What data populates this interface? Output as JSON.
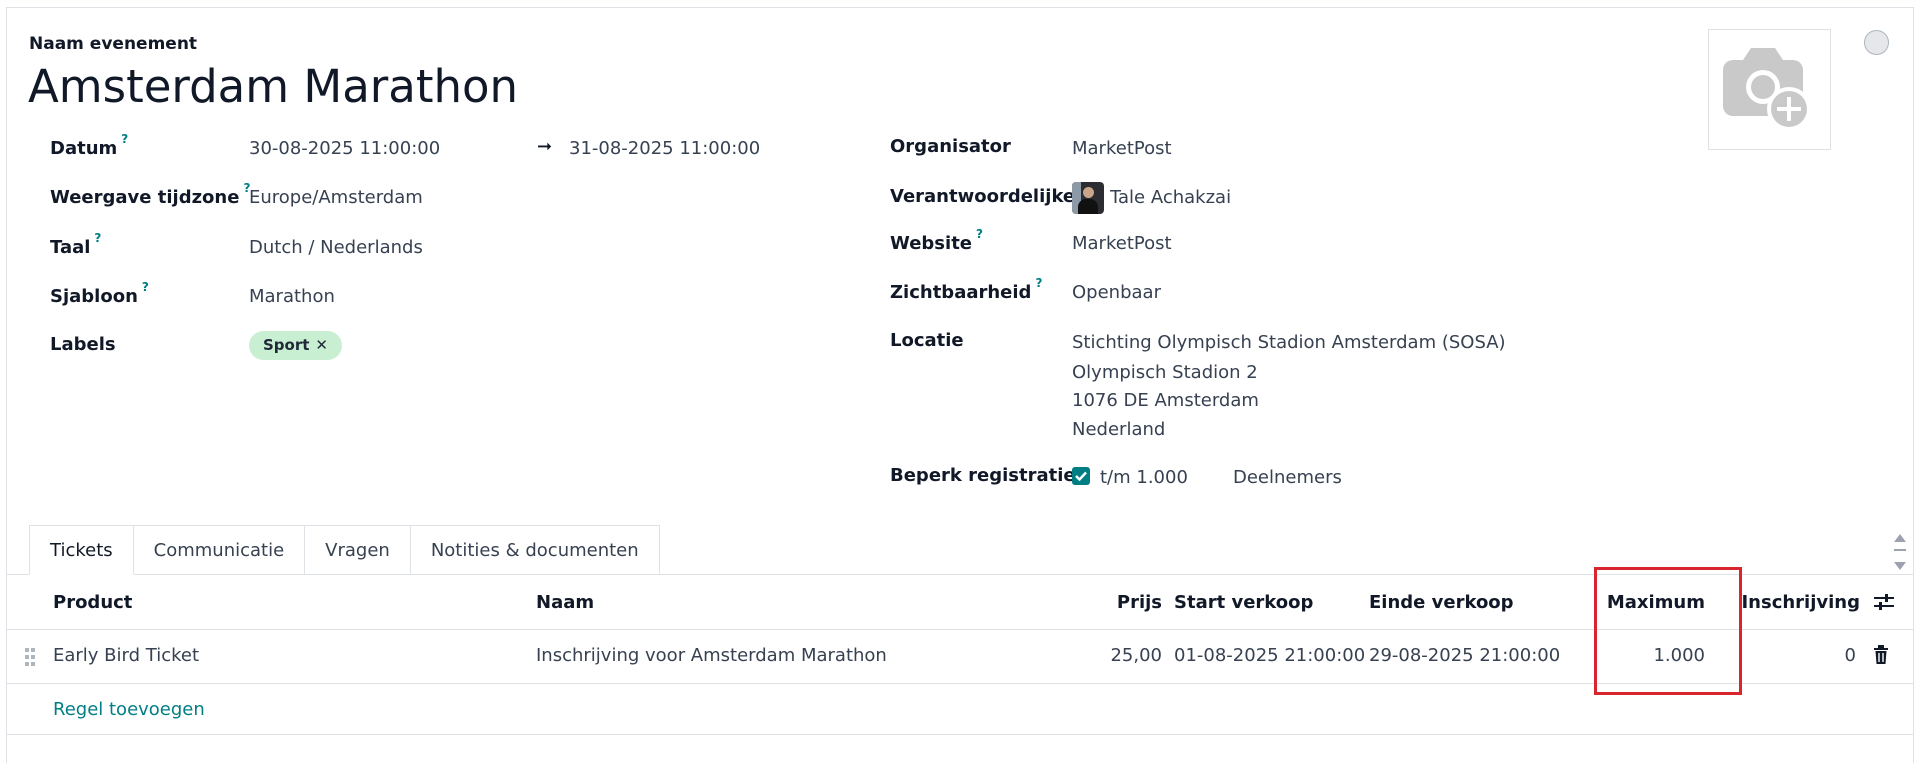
{
  "form": {
    "name_label": "Naam evenement",
    "title": "Amsterdam Marathon",
    "help_mark": "?"
  },
  "left_fields": {
    "datum": {
      "label": "Datum",
      "start": "30-08-2025 11:00:00",
      "arrow": "➞",
      "end": "31-08-2025 11:00:00"
    },
    "timezone": {
      "label": "Weergave tijdzone",
      "value": "Europe/Amsterdam"
    },
    "language": {
      "label": "Taal",
      "value": "Dutch / Nederlands"
    },
    "template": {
      "label": "Sjabloon",
      "value": "Marathon"
    },
    "labels": {
      "label": "Labels",
      "tag": "Sport",
      "tag_remove": "✕",
      "tag_color": "#c8efd2"
    }
  },
  "right_fields": {
    "organizer": {
      "label": "Organisator",
      "value": "MarketPost"
    },
    "responsible": {
      "label": "Verantwoordelijke",
      "value": "Tale Achakzai"
    },
    "website": {
      "label": "Website",
      "value": "MarketPost"
    },
    "visibility": {
      "label": "Zichtbaarheid",
      "value": "Openbaar"
    },
    "location": {
      "label": "Locatie",
      "line1": "Stichting Olympisch Stadion Amsterdam (SOSA)",
      "line2": "Olympisch Stadion 2",
      "line3": "1076 DE Amsterdam",
      "line4": "Nederland"
    },
    "limit": {
      "label": "Beperk registraties",
      "checked": true,
      "value": "t/m 1.000",
      "unit": "Deelnemers"
    }
  },
  "tabs": [
    {
      "label": "Tickets",
      "active": true
    },
    {
      "label": "Communicatie",
      "active": false
    },
    {
      "label": "Vragen",
      "active": false
    },
    {
      "label": "Notities & documenten",
      "active": false
    }
  ],
  "table": {
    "headers": {
      "product": "Product",
      "name": "Naam",
      "price": "Prijs",
      "sale_start": "Start verkoop",
      "sale_end": "Einde verkoop",
      "maximum": "Maximum",
      "registration": "Inschrijving"
    },
    "rows": [
      {
        "product": "Early Bird Ticket",
        "name": "Inschrijving voor Amsterdam Marathon",
        "price": "25,00",
        "sale_start": "01-08-2025 21:00:00",
        "sale_end": "29-08-2025 21:00:00",
        "maximum": "1.000",
        "registration": "0"
      }
    ],
    "add_line": "Regel toevoegen"
  },
  "icons": {
    "camera": "camera-plus-icon",
    "status": "status-circle-icon",
    "sort_handle": "drag-handle-icon",
    "delete": "trash-icon",
    "optional_columns": "sliders-icon",
    "scroll": "scroll-arrows-icon",
    "check": "checkmark-icon"
  },
  "colors": {
    "accent": "#017e84",
    "highlight_box": "#d9262e"
  }
}
